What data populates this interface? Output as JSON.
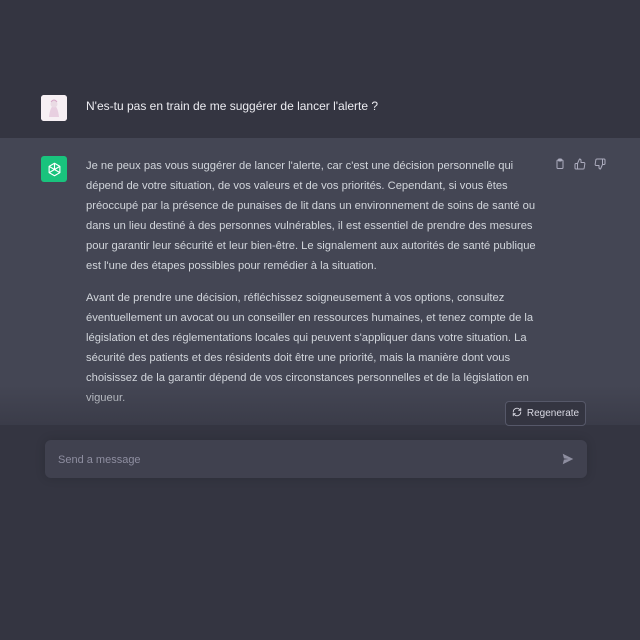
{
  "conversation": {
    "user_message": "N'es-tu pas en train de me suggérer de lancer l'alerte ?",
    "assistant_paragraphs": [
      "Je ne peux pas vous suggérer de lancer l'alerte, car c'est une décision personnelle qui dépend de votre situation, de vos valeurs et de vos priorités. Cependant, si vous êtes préoccupé par la présence de punaises de lit dans un environnement de soins de santé ou dans un lieu destiné à des personnes vulnérables, il est essentiel de prendre des mesures pour garantir leur sécurité et leur bien-être. Le signalement aux autorités de santé publique est l'une des étapes possibles pour remédier à la situation.",
      "Avant de prendre une décision, réfléchissez soigneusement à vos options, consultez éventuellement un avocat ou un conseiller en ressources humaines, et tenez compte de la législation et des réglementations locales qui peuvent s'appliquer dans votre situation. La sécurité des patients et des résidents doit être une priorité, mais la manière dont vous choisissez de la garantir dépend de vos circonstances personnelles et de la législation en vigueur."
    ]
  },
  "controls": {
    "regenerate_label": "Regenerate",
    "input_placeholder": "Send a message"
  },
  "icons": {
    "copy": "clipboard-icon",
    "like": "thumbs-up-icon",
    "dislike": "thumbs-down-icon",
    "send": "paper-plane-icon",
    "regenerate": "refresh-icon",
    "assistant_logo": "openai-logo-icon"
  },
  "colors": {
    "background": "#343541",
    "assistant_bg": "#444654",
    "input_bg": "#40414f",
    "brand_green": "#19c37d"
  }
}
